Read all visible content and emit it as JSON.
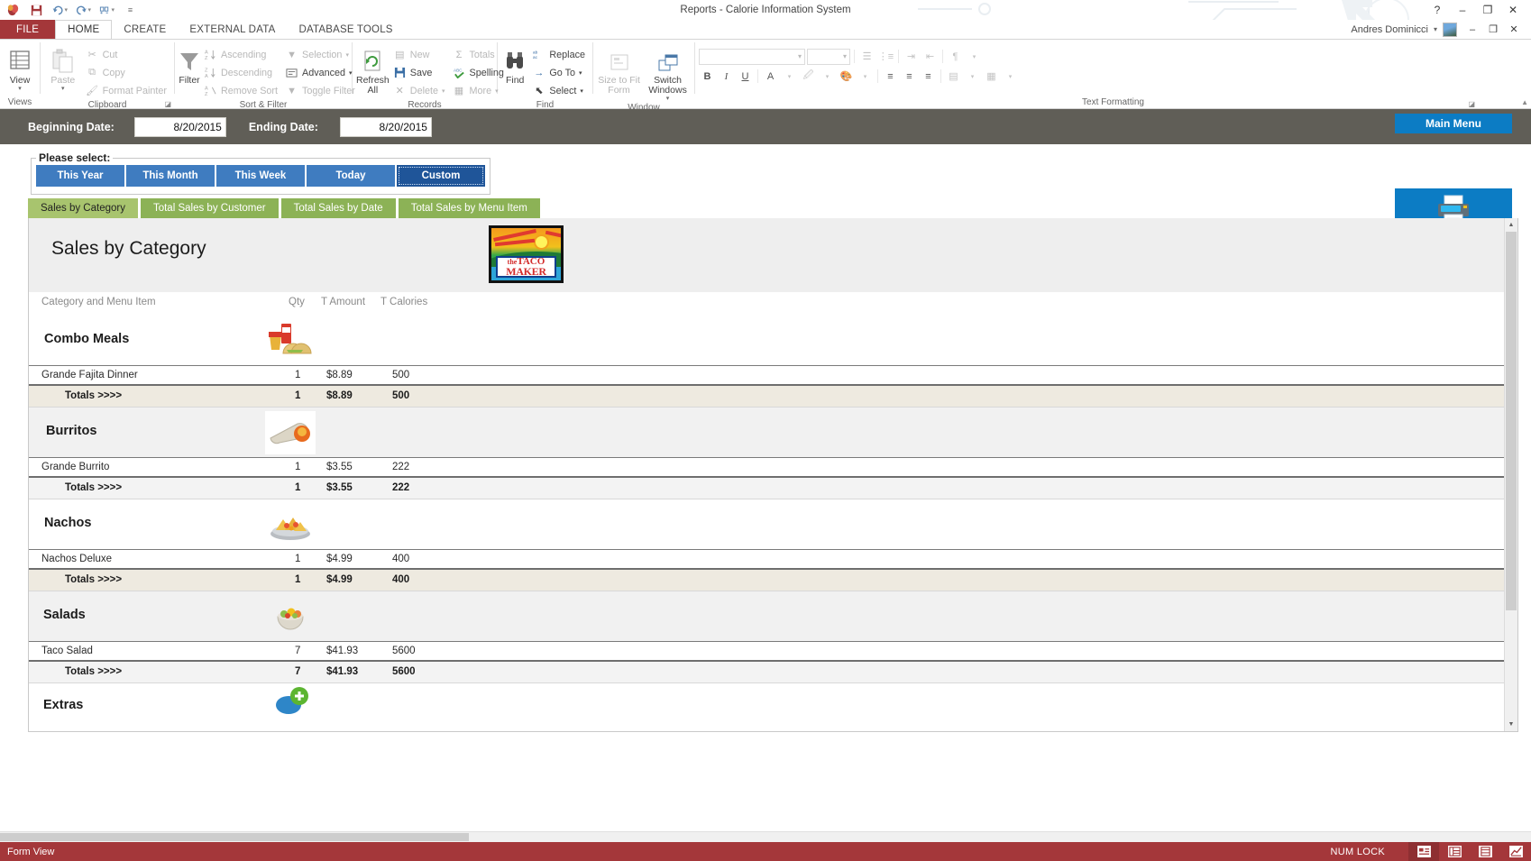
{
  "titlebar": {
    "window_title": "Reports - Calorie Information System",
    "quick_access": [
      {
        "name": "access-icon",
        "glyph": "❖"
      },
      {
        "name": "save-icon",
        "glyph": "ὋE"
      },
      {
        "name": "undo-icon",
        "glyph": "↶"
      },
      {
        "name": "redo-icon",
        "glyph": "↷"
      },
      {
        "name": "customize-icon",
        "glyph": "↕"
      },
      {
        "name": "qat-dropdown-icon",
        "glyph": "≡"
      }
    ],
    "help": "?",
    "minimize": "–",
    "restore": "❐",
    "close": "✕"
  },
  "ribbon": {
    "tabs": [
      {
        "label": "FILE",
        "active": false
      },
      {
        "label": "HOME",
        "active": true
      },
      {
        "label": "CREATE",
        "active": false
      },
      {
        "label": "EXTERNAL DATA",
        "active": false
      },
      {
        "label": "DATABASE TOOLS",
        "active": false
      }
    ],
    "user_name": "Andres Dominicci",
    "groups": {
      "views": {
        "label": "Views",
        "view_button": "View"
      },
      "clipboard": {
        "label": "Clipboard",
        "paste": "Paste",
        "cut": "Cut",
        "copy": "Copy",
        "format_painter": "Format Painter"
      },
      "sort_filter": {
        "label": "Sort & Filter",
        "filter": "Filter",
        "ascending": "Ascending",
        "descending": "Descending",
        "remove_sort": "Remove Sort",
        "selection": "Selection",
        "advanced": "Advanced",
        "toggle_filter": "Toggle Filter"
      },
      "records": {
        "label": "Records",
        "refresh_all": "Refresh All",
        "new": "New",
        "save": "Save",
        "delete": "Delete",
        "totals": "Totals",
        "spelling": "Spelling",
        "more": "More"
      },
      "find": {
        "label": "Find",
        "find": "Find",
        "replace": "Replace",
        "go_to": "Go To",
        "select": "Select"
      },
      "window": {
        "label": "Window",
        "size_to_fit_form": "Size to Fit Form",
        "switch_windows": "Switch Windows"
      },
      "text_formatting": {
        "label": "Text Formatting",
        "bold": "B",
        "italic": "I",
        "underline": "U"
      }
    }
  },
  "form": {
    "beginning_date_label": "Beginning Date:",
    "beginning_date_value": "8/20/2015",
    "ending_date_label": "Ending Date:",
    "ending_date_value": "8/20/2015",
    "main_menu_button": "Main Menu",
    "print_report_button": "Print Report",
    "please_select_label": "Please select:",
    "range_buttons": [
      {
        "label": "This Year",
        "selected": false
      },
      {
        "label": "This Month",
        "selected": false
      },
      {
        "label": "This Week",
        "selected": false
      },
      {
        "label": "Today",
        "selected": false
      },
      {
        "label": "Custom",
        "selected": true
      }
    ],
    "report_tabs": [
      {
        "label": "Sales by Category",
        "active": true
      },
      {
        "label": "Total Sales by Customer",
        "active": false
      },
      {
        "label": "Total Sales by Date",
        "active": false
      },
      {
        "label": "Total Sales by Menu Item",
        "active": false
      }
    ]
  },
  "report": {
    "title": "Sales by Category",
    "logo": {
      "line1_small": "the",
      "line1_big": "TACO",
      "line2": "MAKER"
    },
    "columns": {
      "category": "Category and Menu Item",
      "qty": "Qty",
      "amount": "T Amount",
      "calories": "T Calories"
    },
    "totals_label": "Totals >>>>",
    "groups": [
      {
        "category": "Combo Meals",
        "icon": "combo-meal-icon",
        "items": [
          {
            "name": "Grande Fajita Dinner",
            "qty": "1",
            "amount": "$8.89",
            "calories": "500"
          }
        ],
        "totals": {
          "qty": "1",
          "amount": "$8.89",
          "calories": "500"
        }
      },
      {
        "category": "Burritos",
        "icon": "burrito-icon",
        "items": [
          {
            "name": "Grande Burrito",
            "qty": "1",
            "amount": "$3.55",
            "calories": "222"
          }
        ],
        "totals": {
          "qty": "1",
          "amount": "$3.55",
          "calories": "222"
        }
      },
      {
        "category": "Nachos",
        "icon": "nachos-icon",
        "items": [
          {
            "name": "Nachos Deluxe",
            "qty": "1",
            "amount": "$4.99",
            "calories": "400"
          }
        ],
        "totals": {
          "qty": "1",
          "amount": "$4.99",
          "calories": "400"
        }
      },
      {
        "category": "Salads",
        "icon": "salad-icon",
        "items": [
          {
            "name": "Taco Salad",
            "qty": "7",
            "amount": "$41.93",
            "calories": "5600"
          }
        ],
        "totals": {
          "qty": "7",
          "amount": "$41.93",
          "calories": "5600"
        }
      },
      {
        "category": "Extras",
        "icon": "extras-icon",
        "items": [],
        "totals": null
      }
    ]
  },
  "statusbar": {
    "view_mode": "Form View",
    "num_lock": "NUM LOCK"
  },
  "colors": {
    "accent_red": "#a4373a",
    "button_blue": "#3f7cc0",
    "button_blue_selected": "#1f5599",
    "action_blue": "#0c7cc4",
    "tab_green": "#8cb256",
    "tab_green_active": "#a8c46e",
    "datebar_gray": "#605e57",
    "totals_beige": "#eeeae0"
  }
}
